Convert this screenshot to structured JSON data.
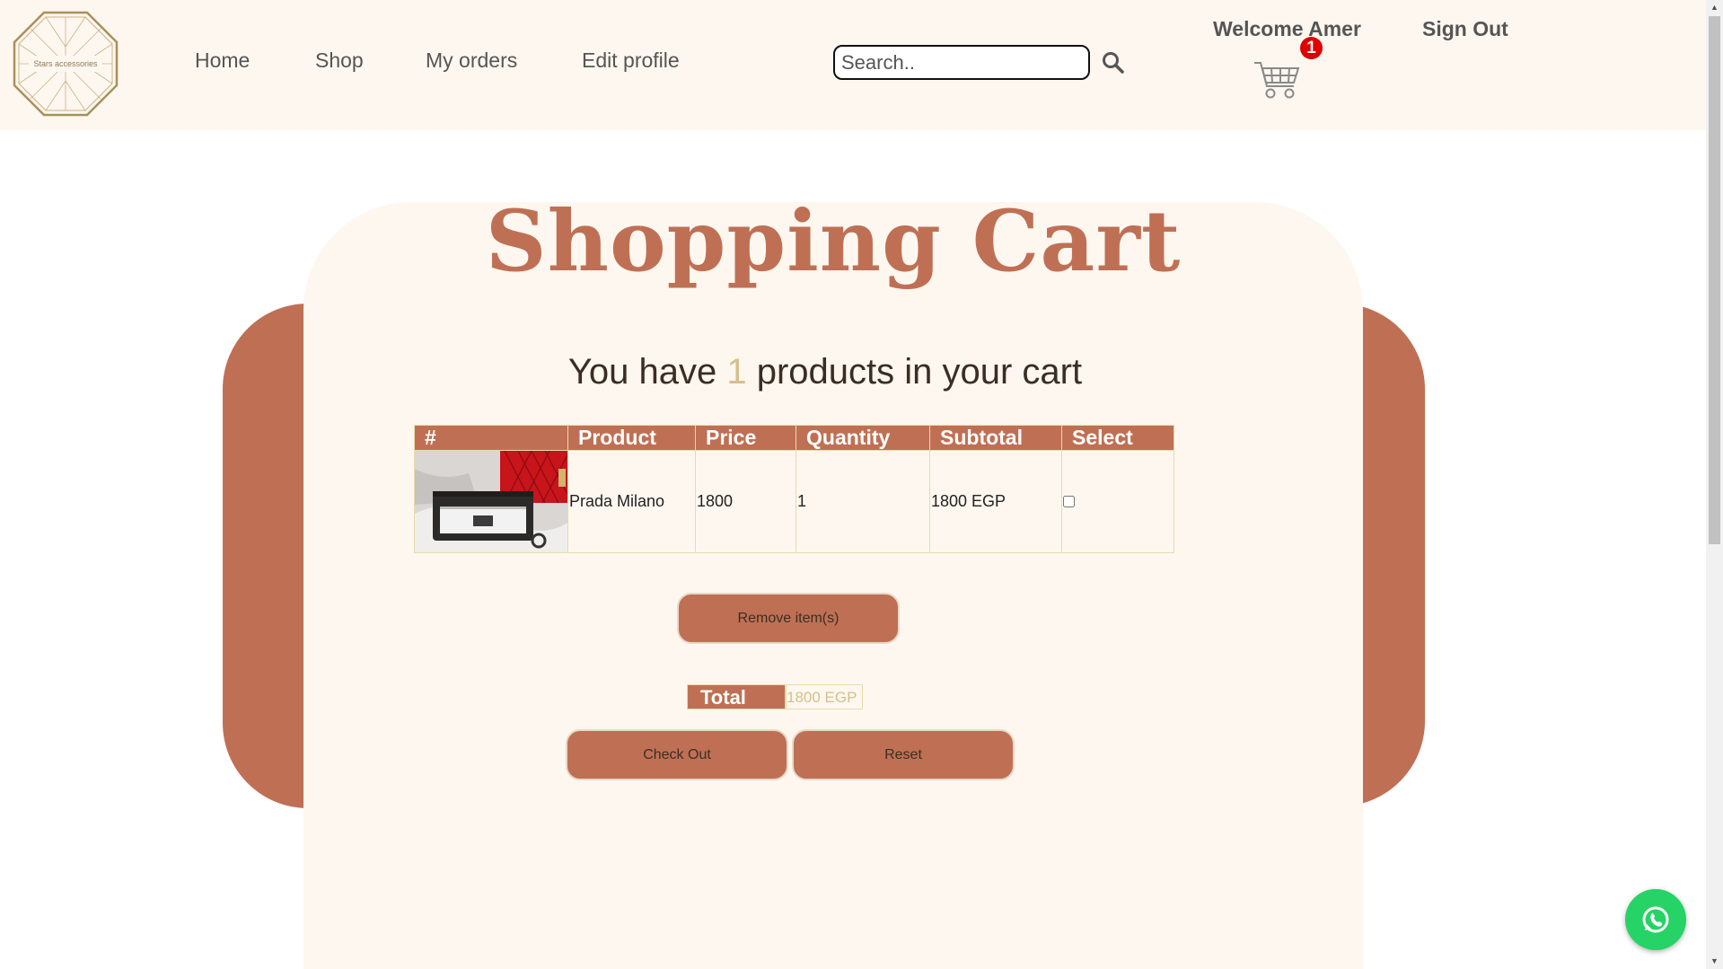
{
  "header": {
    "logo_text": "Stars accessories",
    "nav": [
      {
        "label": "Home"
      },
      {
        "label": "Shop"
      },
      {
        "label": "My orders"
      },
      {
        "label": "Edit profile"
      }
    ],
    "search": {
      "placeholder": "Search..",
      "value": ""
    },
    "welcome": "Welcome Amer",
    "signout": "Sign Out",
    "cart_badge": "1"
  },
  "page": {
    "title": "Shopping Cart",
    "summary_prefix": "You have ",
    "summary_count": "1",
    "summary_suffix": " products in your cart"
  },
  "table": {
    "headers": [
      "#",
      "Product",
      "Price",
      "Quantity",
      "Subtotal",
      "Select"
    ],
    "rows": [
      {
        "product": "Prada Milano",
        "price": "1800",
        "quantity": "1",
        "subtotal": "1800 EGP",
        "selected": false
      }
    ]
  },
  "actions": {
    "remove": "Remove item(s)",
    "total_label": "Total",
    "total_value": "1800 EGP",
    "checkout": "Check Out",
    "reset": "Reset"
  },
  "colors": {
    "accent": "#bf7054",
    "cream": "#fef7f0",
    "gold": "#d4c08c",
    "badge": "#e00000",
    "whatsapp": "#25d366"
  },
  "icons": [
    "logo-icon",
    "search-icon",
    "cart-icon",
    "whatsapp-icon",
    "scroll-up-icon",
    "scroll-down-icon"
  ]
}
